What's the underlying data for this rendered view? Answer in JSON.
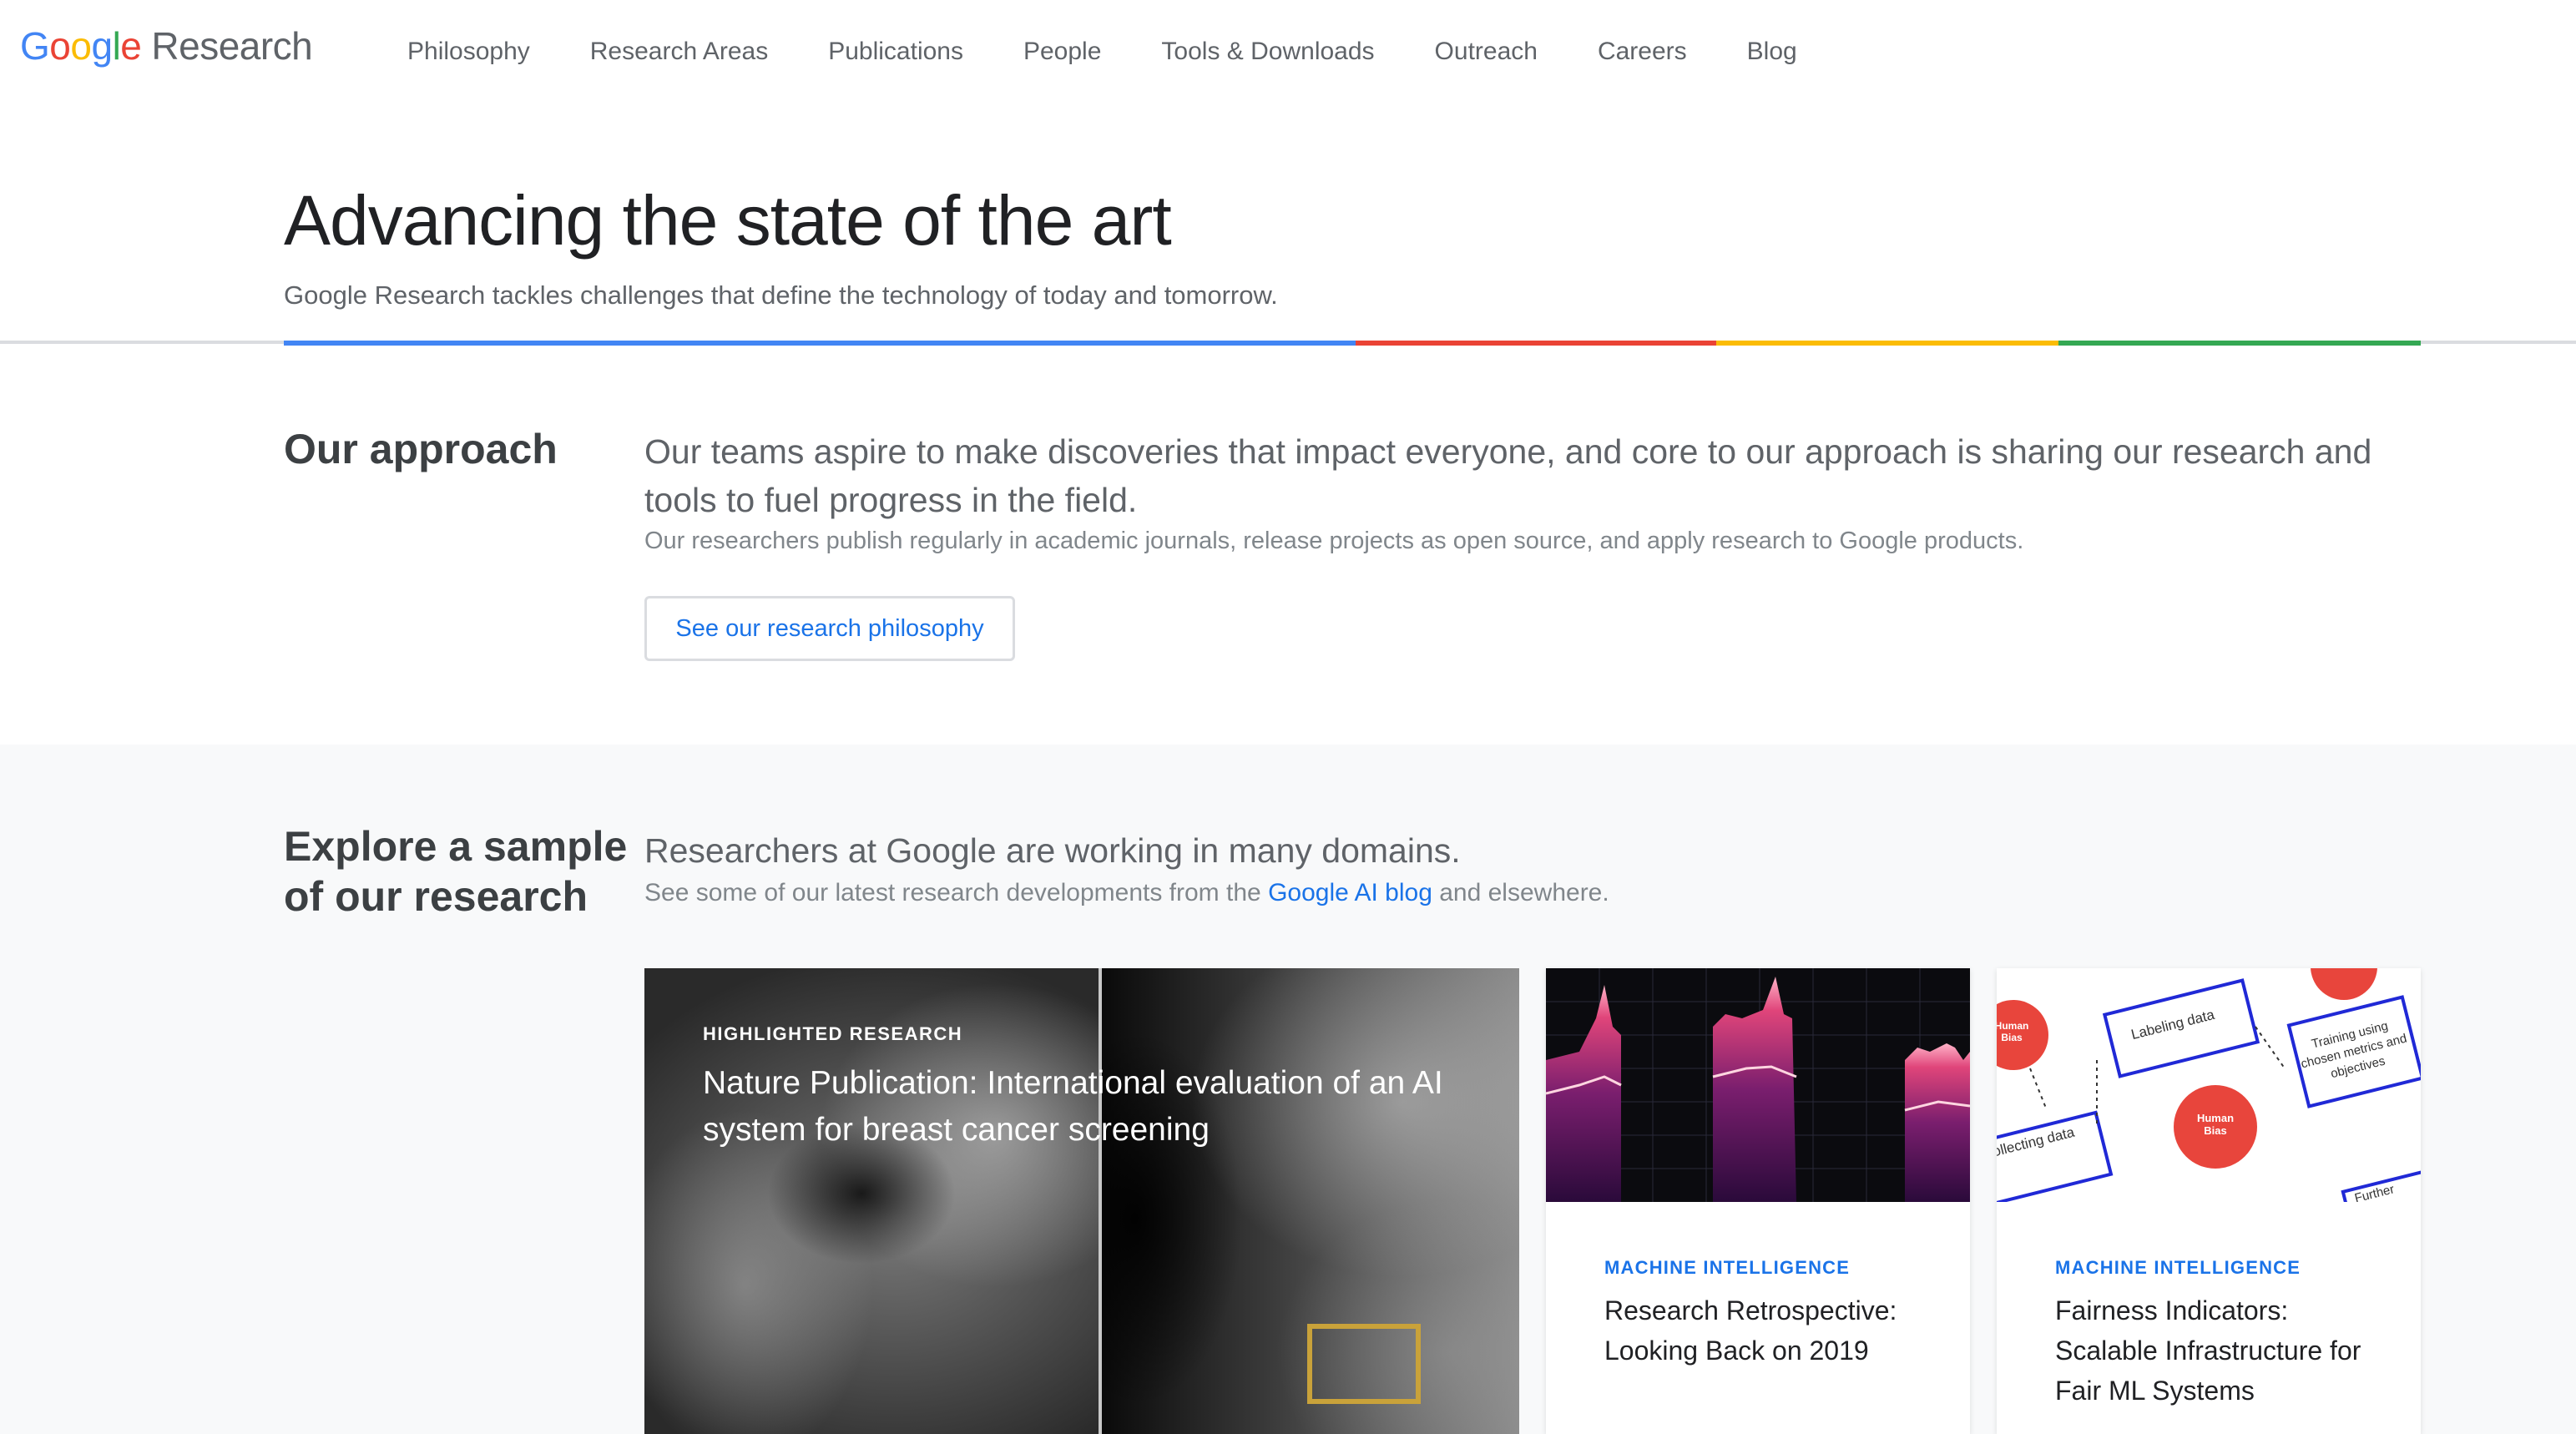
{
  "header": {
    "logo_google": [
      "G",
      "o",
      "o",
      "g",
      "l",
      "e"
    ],
    "logo_colors": [
      "#4285F4",
      "#EA4335",
      "#FBBC05",
      "#4285F4",
      "#34A853",
      "#EA4335"
    ],
    "logo_research": "Research",
    "nav": [
      "Philosophy",
      "Research Areas",
      "Publications",
      "People",
      "Tools & Downloads",
      "Outreach",
      "Careers",
      "Blog"
    ]
  },
  "hero": {
    "title": "Advancing the state of the art",
    "subtitle": "Google Research tackles challenges that define the technology of today and tomorrow.",
    "rule_colors": [
      "#4285F4",
      "#EA4335",
      "#FBBC05",
      "#34A853"
    ]
  },
  "approach": {
    "title": "Our approach",
    "lead": "Our teams aspire to make discoveries that impact everyone, and core to our approach is sharing our research and tools to fuel progress in the field.",
    "body": "Our researchers publish regularly in academic journals, release projects as open source, and apply research to Google products.",
    "button_label": "See our research philosophy"
  },
  "explore": {
    "title": "Explore a sample of our research",
    "lead": "Researchers at Google are working in many domains.",
    "body_prefix": "See some of our latest research developments from the",
    "body_link": "Google AI blog",
    "body_suffix": "and elsewhere."
  },
  "featured": {
    "kicker": "HIGHLIGHTED RESEARCH",
    "headline": "Nature Publication: International evaluation of an AI system for breast cancer screening"
  },
  "cards": [
    {
      "topic": "MACHINE INTELLIGENCE",
      "title": "Research Retrospective: Looking Back on 2019"
    },
    {
      "topic": "MACHINE INTELLIGENCE",
      "title": "Fairness Indicators: Scalable Infrastructure for Fair ML Systems"
    }
  ],
  "fairness_diagram": {
    "boxes": [
      "Labeling data",
      "Training using chosen metrics and objectives",
      "Collecting data",
      "Further data"
    ],
    "bias_label": "Human Bias"
  },
  "accent_color": "#1a73e8"
}
